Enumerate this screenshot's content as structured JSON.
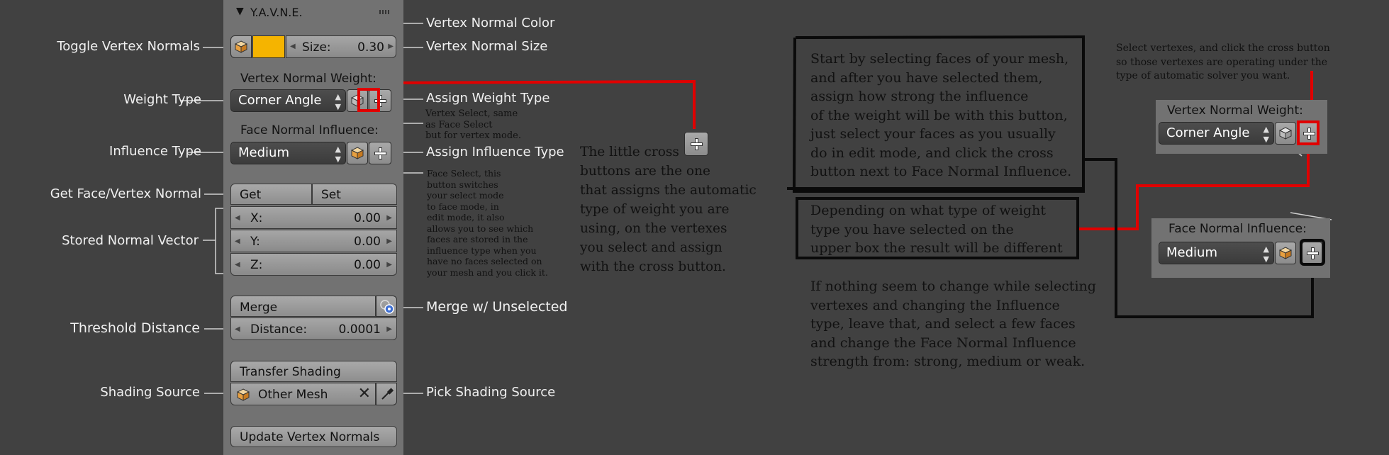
{
  "panel": {
    "title": "Y.A.V.N.E.",
    "size_label": "Size:",
    "size_value": "0.30",
    "vertex_color": "#f5b400",
    "weight_section": "Vertex Normal Weight:",
    "weight_value": "Corner Angle",
    "influence_section": "Face Normal Influence:",
    "influence_value": "Medium",
    "get_label": "Get",
    "set_label": "Set",
    "x_label": "X:",
    "x_value": "0.00",
    "y_label": "Y:",
    "y_value": "0.00",
    "z_label": "Z:",
    "z_value": "0.00",
    "merge_label": "Merge",
    "distance_label": "Distance:",
    "distance_value": "0.0001",
    "transfer_label": "Transfer Shading",
    "source_value": "Other Mesh",
    "update_label": "Update Vertex Normals"
  },
  "left_labels": {
    "toggle": "Toggle Vertex Normals",
    "weight_type": "Weight Type",
    "influence_type": "Influence Type",
    "get_face": "Get Face/Vertex Normal",
    "stored": "Stored Normal Vector",
    "threshold": "Threshold Distance",
    "shading_source": "Shading Source"
  },
  "right_labels": {
    "vertex_color": "Vertex Normal Color",
    "vertex_size": "Vertex Normal Size",
    "assign_weight": "Assign Weight Type",
    "assign_influence": "Assign Influence Type",
    "merge_unselected": "Merge w/ Unselected",
    "pick_source": "Pick Shading Source"
  },
  "notes": {
    "vertex_select": [
      "Vertex Select, same",
      "as Face Select",
      "but for vertex mode."
    ],
    "face_select": [
      "Face Select, this",
      "button switches",
      "your select mode",
      "to face mode, in",
      "edit mode, it also",
      "allows you to see which",
      "faces are stored in the",
      "influence type when you",
      "have no faces selected on",
      "your mesh and you click it."
    ],
    "cross": [
      "The little cross",
      "buttons are the one",
      "that assigns the automatic",
      "type of weight you are",
      "using, on the vertexes",
      "you select and assign",
      "with the cross button."
    ],
    "start": [
      "Start by selecting faces of your mesh,",
      "and after you  have selected them,",
      "assign how strong the influence",
      "of the weight will be with this button,",
      "just select your faces as you usually",
      "do in edit mode, and click the cross",
      "button next to Face Normal Influence."
    ],
    "depending": [
      "Depending on what type of weight",
      "type you have selected on the",
      "upper box the result will be different"
    ],
    "nothing": [
      "If nothing seem to change while selecting",
      "vertexes and changing the Influence",
      "type, leave that, and select a few faces",
      "and change the Face Normal Influence",
      "strength from: strong, medium or weak."
    ],
    "select_vertexes": [
      "Select vertexes, and click the cross button",
      "so those vertexes are operating under the",
      "type of automatic solver you want."
    ]
  },
  "inset": {
    "weight_section": "Vertex Normal Weight:",
    "weight_value": "Corner Angle",
    "influence_section": "Face Normal Influence:",
    "influence_value": "Medium"
  },
  "colors": {
    "background": "#414141",
    "panel": "#727272",
    "highlight_red": "#e00000",
    "vertex_color": "#f5b400"
  },
  "icons": [
    "cube-icon",
    "plus-icon",
    "close-icon",
    "eyedropper-icon",
    "merge-icon",
    "collapse-triangle-icon",
    "drag-grip-icon"
  ]
}
